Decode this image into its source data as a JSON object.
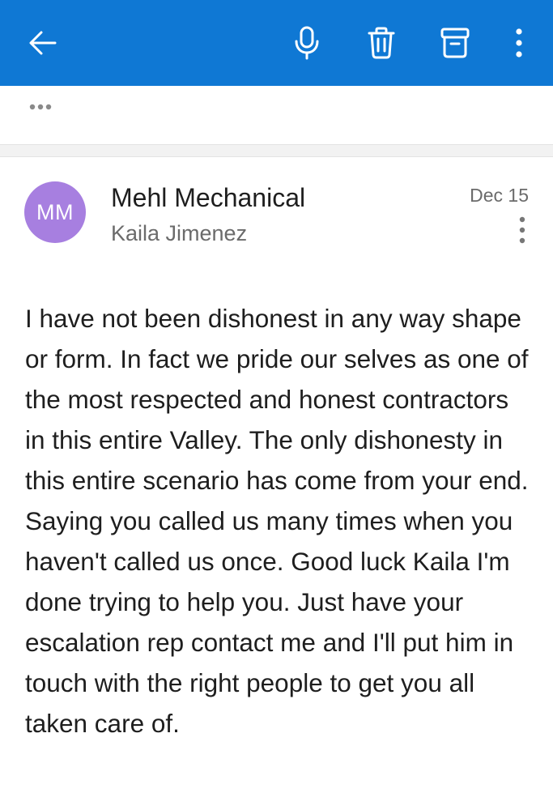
{
  "toolbar": {
    "background_color": "#0f78d4",
    "icons": [
      "arrow-left-icon",
      "microphone-icon",
      "trash-icon",
      "archive-icon",
      "more-vertical-icon"
    ]
  },
  "thread": {
    "collapsed_icon": "more-horizontal-icon"
  },
  "message": {
    "avatar_initials": "MM",
    "avatar_color": "#a77fe0",
    "sender": "Mehl Mechanical",
    "recipient": "Kaila Jimenez",
    "date": "Dec 15",
    "body": "I have not been dishonest in any way shape or form. In fact we pride our selves as one of the most respected and honest contractors in this entire Valley. The only dishonesty in this entire scenario has come from your end. Saying you called us many times when you haven't called us once. Good luck Kaila I'm done trying to help you. Just have your escalation rep contact me and I'll put him in touch with the right people to get you all taken care of."
  }
}
